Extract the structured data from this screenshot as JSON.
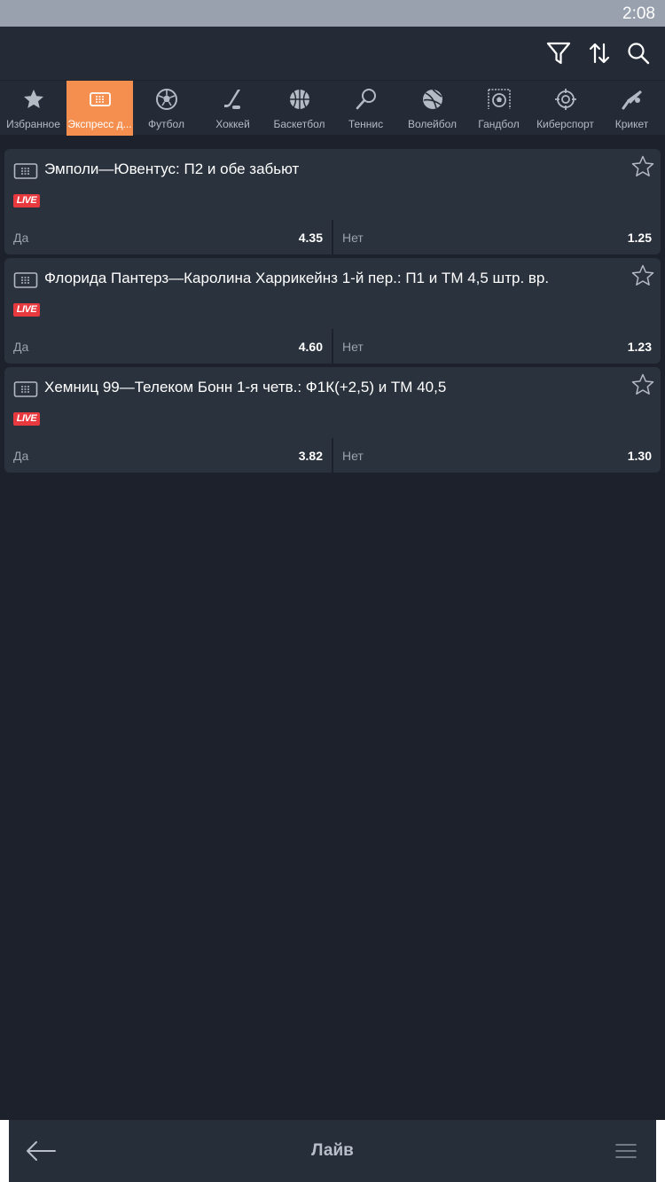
{
  "status_bar": {
    "time": "2:08"
  },
  "toolbar": {
    "icons": [
      "filter-icon",
      "sort-icon",
      "search-icon"
    ]
  },
  "sports": [
    {
      "label": "Избранное",
      "icon": "star-icon",
      "active": false
    },
    {
      "label": "Экспресс д...",
      "icon": "ticket-icon",
      "active": true
    },
    {
      "label": "Футбол",
      "icon": "soccer-ball-icon",
      "active": false
    },
    {
      "label": "Хоккей",
      "icon": "hockey-stick-icon",
      "active": false
    },
    {
      "label": "Баскетбол",
      "icon": "basketball-icon",
      "active": false
    },
    {
      "label": "Теннис",
      "icon": "tennis-racket-icon",
      "active": false
    },
    {
      "label": "Волейбол",
      "icon": "volleyball-icon",
      "active": false
    },
    {
      "label": "Гандбол",
      "icon": "handball-icon",
      "active": false
    },
    {
      "label": "Киберспорт",
      "icon": "crosshair-icon",
      "active": false
    },
    {
      "label": "Крикет",
      "icon": "cricket-icon",
      "active": false
    }
  ],
  "events": [
    {
      "title": "Эмполи—Ювентус: П2 и обе забьют",
      "badge": "LIVE",
      "yes_label": "Да",
      "yes_value": "4.35",
      "no_label": "Нет",
      "no_value": "1.25"
    },
    {
      "title": "Флорида Пантерз—Каролина Харрикейнз 1-й пер.: П1 и ТМ 4,5 штр. вр.",
      "badge": "LIVE",
      "yes_label": "Да",
      "yes_value": "4.60",
      "no_label": "Нет",
      "no_value": "1.23"
    },
    {
      "title": "Хемниц 99—Телеком Бонн 1-я четв.: Ф1К(+2,5) и ТМ 40,5",
      "badge": "LIVE",
      "yes_label": "Да",
      "yes_value": "3.82",
      "no_label": "Нет",
      "no_value": "1.30"
    }
  ],
  "bottom_bar": {
    "title": "Лайв"
  },
  "colors": {
    "accent": "#f58f4f",
    "live": "#e8393f",
    "background": "#1c212b",
    "card": "#2a323d"
  }
}
